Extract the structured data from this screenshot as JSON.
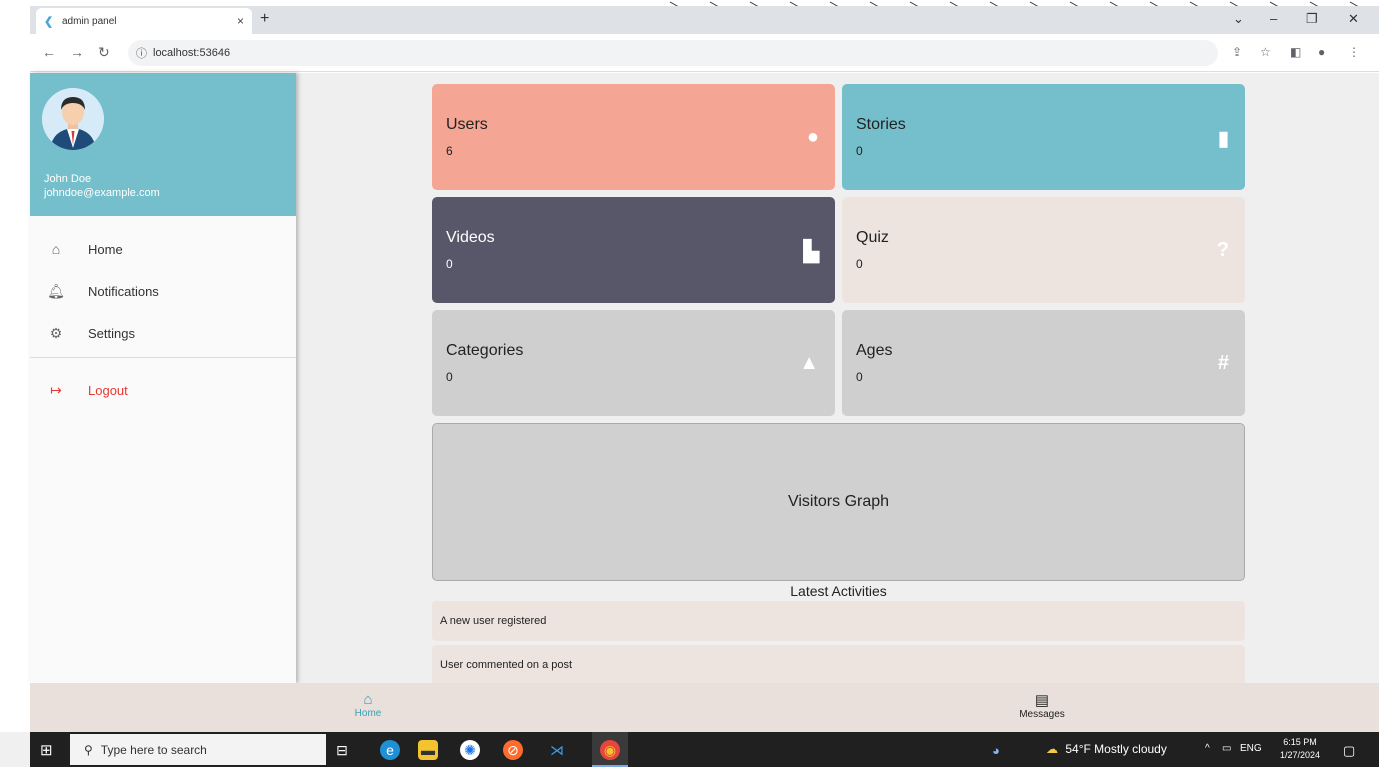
{
  "browser": {
    "tab_title": "admin panel",
    "tab_close": "×",
    "new_tab": "+",
    "url": "localhost:53646",
    "controls": {
      "minimize": "–",
      "restore": "❐",
      "close": "✕",
      "chevron": "⌄"
    }
  },
  "drawer": {
    "user_name": "John Doe",
    "user_email": "johndoe@example.com",
    "items": [
      {
        "label": "Home",
        "icon": "home-icon"
      },
      {
        "label": "Notifications",
        "icon": "bell-icon"
      },
      {
        "label": "Settings",
        "icon": "gear-icon"
      },
      {
        "label": "Logout",
        "icon": "logout-icon"
      }
    ],
    "logout_color": "#e53935"
  },
  "cards": [
    {
      "title": "Users",
      "value": "6",
      "icon": "person-icon",
      "color": "#f5a593"
    },
    {
      "title": "Stories",
      "value": "0",
      "icon": "book-icon",
      "color": "#74bfcb"
    },
    {
      "title": "Videos",
      "value": "0",
      "icon": "file-icon",
      "color": "#585769"
    },
    {
      "title": "Quiz",
      "value": "0",
      "icon": "question-icon",
      "color": "#ede4df"
    },
    {
      "title": "Categories",
      "value": "0",
      "icon": "shapes-icon",
      "color": "#cfcfcf"
    },
    {
      "title": "Ages",
      "value": "0",
      "icon": "hash-icon",
      "color": "#cfcfcf"
    }
  ],
  "graph": {
    "label": "Visitors Graph"
  },
  "activities": {
    "title": "Latest Activities",
    "items": [
      "A new user registered",
      "User commented on a post"
    ]
  },
  "bottom_nav": [
    {
      "label": "Home",
      "icon": "home-icon",
      "active": true
    },
    {
      "label": "Messages",
      "icon": "chat-icon",
      "active": false
    }
  ],
  "taskbar": {
    "search_placeholder": "Type here to search",
    "weather": "54°F  Mostly cloudy",
    "lang": "ENG",
    "time": "6:15 PM",
    "date": "1/27/2024"
  },
  "colors": {
    "accent": "#74bfcb",
    "active_nav": "#3aa0b5"
  }
}
